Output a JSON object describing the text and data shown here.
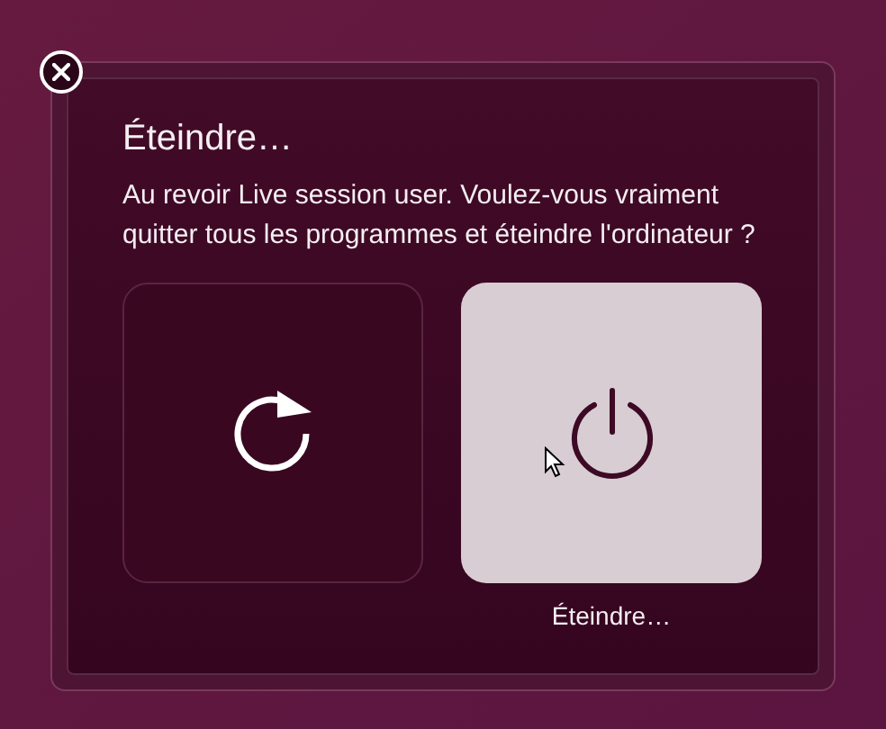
{
  "dialog": {
    "title": "Éteindre…",
    "message": "Au revoir Live session user. Voulez-vous vraiment quitter tous les programmes et éteindre l'ordinateur ?",
    "actions": [
      {
        "kind": "restart",
        "selected": false
      },
      {
        "kind": "shutdown",
        "selected": true,
        "label": "Éteindre…"
      }
    ]
  }
}
